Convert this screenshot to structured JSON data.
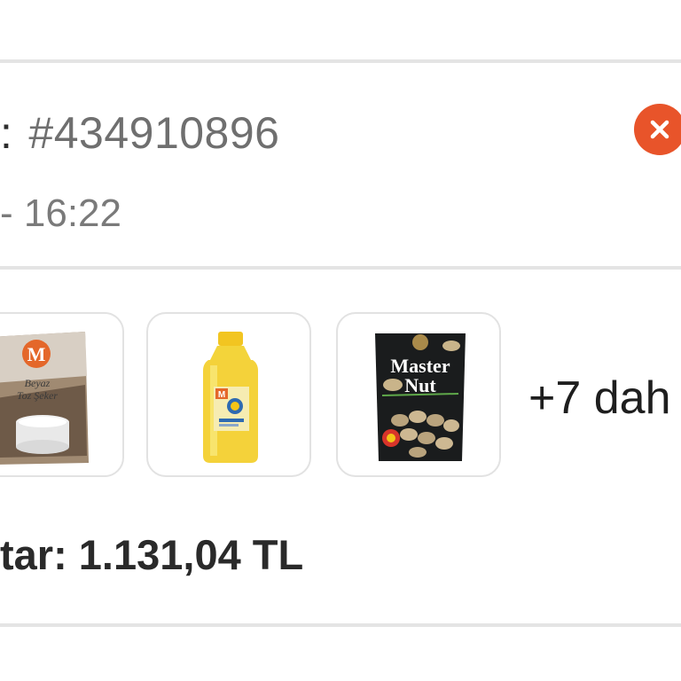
{
  "order": {
    "number_prefix": ":",
    "number": "#434910896",
    "date_line": "- 16:22",
    "cancel_icon": "close-icon"
  },
  "items": {
    "thumbnails": [
      {
        "icon": "sugar-bag-image",
        "logo_letter": "M",
        "text_line1": "Beyaz",
        "text_line2": "Toz Şeker"
      },
      {
        "icon": "oil-bottle-image",
        "logo_letter": "M"
      },
      {
        "icon": "nut-bag-image",
        "brand_line1": "Master",
        "brand_line2": "Nut"
      }
    ],
    "more_label": "+7 dah"
  },
  "summary": {
    "total_label": "tar: 1.131,04 TL"
  },
  "colors": {
    "accent": "#e8542a",
    "divider": "#e4e4e4"
  }
}
